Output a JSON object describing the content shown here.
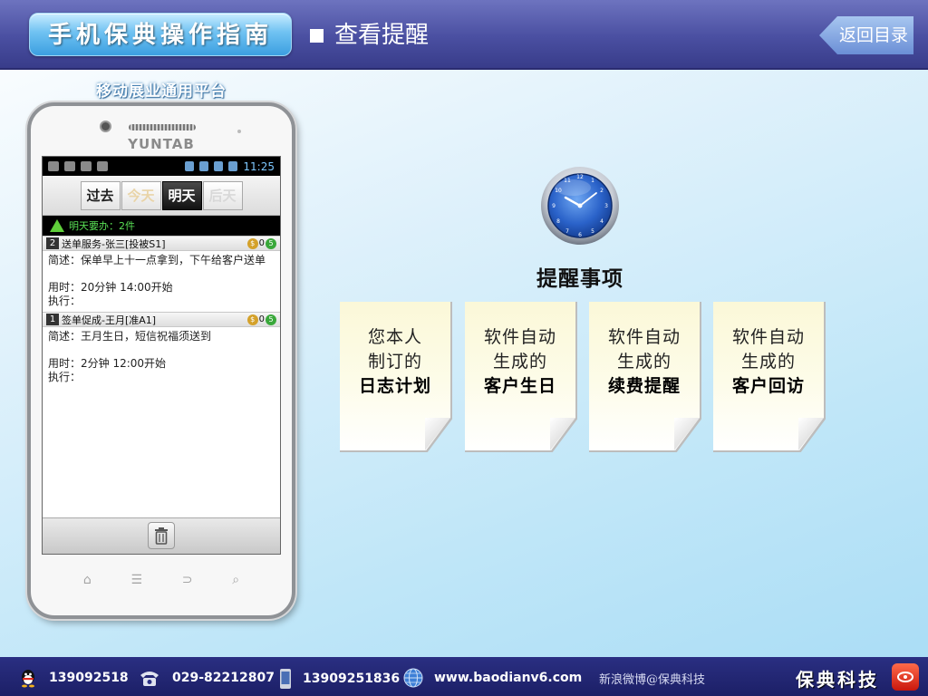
{
  "header": {
    "brand_title": "手机保典操作指南",
    "section_title": "查看提醒",
    "back_label": "返回目录"
  },
  "phone": {
    "platform_label": "移动展业通用平台",
    "device_brand": "YUNTAB",
    "status_time": "11:25",
    "tabs": [
      {
        "label": "过去"
      },
      {
        "label": "今天"
      },
      {
        "label": "明天"
      },
      {
        "label": "后天"
      }
    ],
    "alert_text": "明天要办：2件",
    "items": [
      {
        "number": "2",
        "title": "送单服务-张三[投被S1]",
        "coin_count": "0",
        "coin_gold": "$",
        "coin_green": "5",
        "desc": "简述：保单早上十一点拿到，下午给客户送单",
        "time": "用时：20分钟 14:00开始",
        "exec": "执行："
      },
      {
        "number": "1",
        "title": "签单促成-王月[准A1]",
        "coin_count": "0",
        "coin_gold": "$",
        "coin_green": "5",
        "desc": "简述：王月生日，短信祝福须送到",
        "time": "用时：2分钟 12:00开始",
        "exec": "执行："
      }
    ]
  },
  "main": {
    "reminder_title": "提醒事项",
    "cards": [
      {
        "line1": "您本人",
        "line2": "制订的",
        "line3": "日志计划"
      },
      {
        "line1": "软件自动",
        "line2": "生成的",
        "line3": "客户生日"
      },
      {
        "line1": "软件自动",
        "line2": "生成的",
        "line3": "续费提醒"
      },
      {
        "line1": "软件自动",
        "line2": "生成的",
        "line3": "客户回访"
      }
    ]
  },
  "footer": {
    "qq": "139092518",
    "phone": "029-82212807",
    "mobile": "13909251836",
    "website": "www.baodianv6.com",
    "weibo": "新浪微博@保典科技",
    "company": "保典科技"
  },
  "colors": {
    "header_bg": "#4a4fa1",
    "footer_bg": "#1c1f66",
    "alert_green": "#59e055",
    "card_bg": "#fdfce9"
  }
}
